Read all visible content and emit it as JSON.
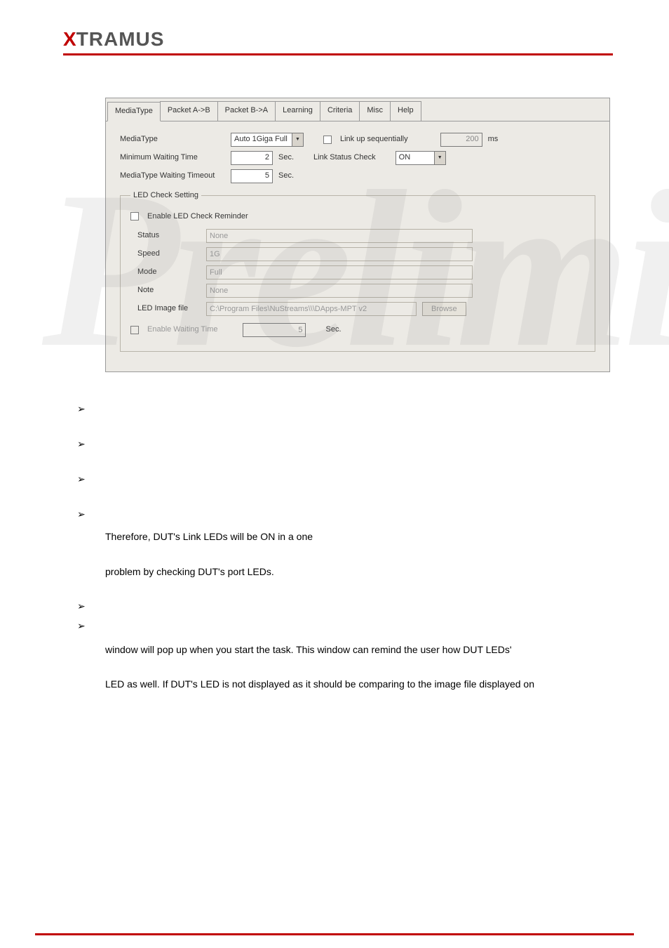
{
  "logo": {
    "x": "X",
    "rest": "TRAMUS"
  },
  "watermark": "Preliminary",
  "dialog": {
    "tabs": [
      "MediaType",
      "Packet A->B",
      "Packet B->A",
      "Learning",
      "Criteria",
      "Misc",
      "Help"
    ],
    "active_tab": "MediaType",
    "mediaType_label": "MediaType",
    "mediaType_value": "Auto 1Giga Full",
    "linkup_label": "Link up sequentially",
    "linkup_ms_value": "200",
    "linkup_ms_unit": "ms",
    "minwait_label": "Minimum Waiting Time",
    "minwait_value": "2",
    "minwait_unit": "Sec.",
    "linkstatus_label": "Link Status Check",
    "linkstatus_value": "ON",
    "mtwt_label": "MediaType Waiting Timeout",
    "mtwt_value": "5",
    "mtwt_unit": "Sec.",
    "led_group": "LED Check Setting",
    "enable_led_label": "Enable LED Check Reminder",
    "status_label": "Status",
    "status_value": "None",
    "speed_label": "Speed",
    "speed_value": "1G",
    "mode_label": "Mode",
    "mode_value": "Full",
    "note_label": "Note",
    "note_value": "None",
    "imgfile_label": "LED Image file",
    "imgfile_value": "C:\\Program Files\\NuStreams\\\\\\DApps-MPT v2",
    "browse_label": "Browse",
    "enable_wait_label": "Enable Waiting Time",
    "enable_wait_value": "5",
    "enable_wait_unit": "Sec."
  },
  "body": {
    "line1": "Therefore, DUT's Link LEDs will be ON in a one",
    "line2": "problem by checking DUT's port LEDs.",
    "line3": "window will pop up when you start the task. This window can remind the user how DUT LEDs'",
    "line4": "LED as well. If DUT's LED is not displayed as it should be comparing to the image file displayed on"
  }
}
